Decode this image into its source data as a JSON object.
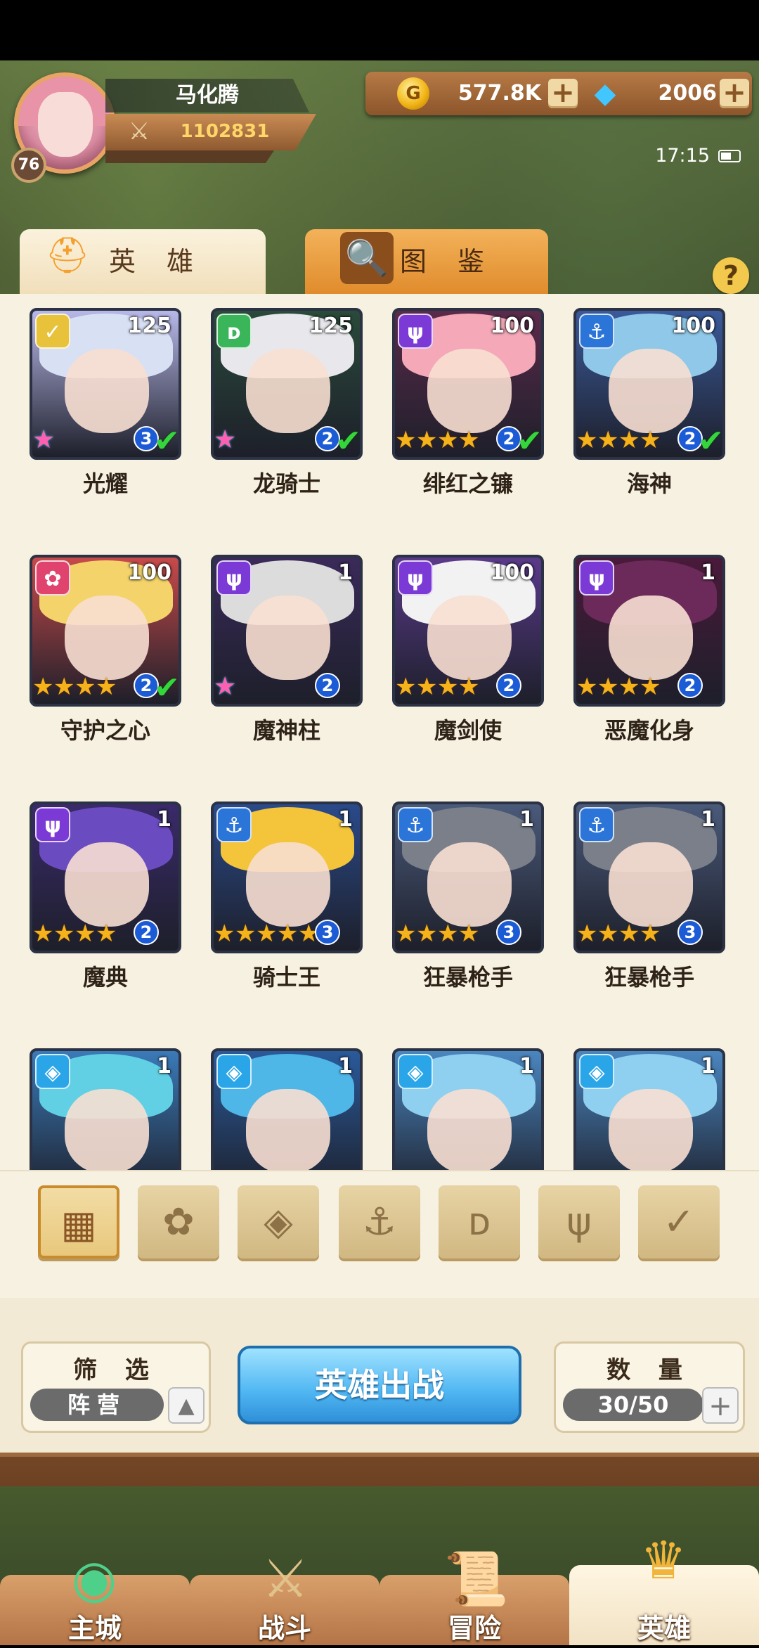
{
  "header": {
    "player_name": "马化腾",
    "player_level": "76",
    "power": "1102831",
    "gold": "577.8K",
    "gems": "2006",
    "clock": "17:15"
  },
  "tabs": [
    {
      "label": "英 雄",
      "icon": "helmet-icon",
      "active": true
    },
    {
      "label": "图 鉴",
      "icon": "magnifier-icon",
      "active": false
    }
  ],
  "help_label": "?",
  "heroes": [
    {
      "name": "光耀",
      "level": "125",
      "faction": "light",
      "stars": 1,
      "rainbow": true,
      "rank": "3",
      "checked": true
    },
    {
      "name": "龙骑士",
      "level": "125",
      "faction": "dragon",
      "stars": 1,
      "rainbow": true,
      "rank": "2",
      "checked": true
    },
    {
      "name": "绯红之镰",
      "level": "100",
      "faction": "demon",
      "stars": 4,
      "rainbow": false,
      "rank": "2",
      "checked": true
    },
    {
      "name": "海神",
      "level": "100",
      "faction": "sea",
      "stars": 4,
      "rainbow": false,
      "rank": "2",
      "checked": true
    },
    {
      "name": "守护之心",
      "level": "100",
      "faction": "nature",
      "stars": 4,
      "rainbow": false,
      "rank": "2",
      "checked": true
    },
    {
      "name": "魔神柱",
      "level": "1",
      "faction": "demon",
      "stars": 1,
      "rainbow": true,
      "rank": "2",
      "checked": false
    },
    {
      "name": "魔剑使",
      "level": "100",
      "faction": "demon",
      "stars": 4,
      "rainbow": false,
      "rank": "2",
      "checked": false
    },
    {
      "name": "恶魔化身",
      "level": "1",
      "faction": "demon",
      "stars": 4,
      "rainbow": false,
      "rank": "2",
      "checked": false
    },
    {
      "name": "魔典",
      "level": "1",
      "faction": "demon",
      "stars": 4,
      "rainbow": false,
      "rank": "2",
      "checked": false
    },
    {
      "name": "骑士王",
      "level": "1",
      "faction": "sea",
      "stars": 5,
      "rainbow": false,
      "rank": "3",
      "checked": false
    },
    {
      "name": "狂暴枪手",
      "level": "1",
      "faction": "sea",
      "stars": 4,
      "rainbow": false,
      "rank": "3",
      "checked": false
    },
    {
      "name": "狂暴枪手",
      "level": "1",
      "faction": "sea",
      "stars": 4,
      "rainbow": false,
      "rank": "3",
      "checked": false
    },
    {
      "name": "",
      "level": "1",
      "faction": "ice",
      "stars": 0,
      "rainbow": false,
      "rank": "",
      "checked": false
    },
    {
      "name": "",
      "level": "1",
      "faction": "ice",
      "stars": 0,
      "rainbow": false,
      "rank": "",
      "checked": false
    },
    {
      "name": "",
      "level": "1",
      "faction": "ice",
      "stars": 0,
      "rainbow": false,
      "rank": "",
      "checked": false
    },
    {
      "name": "",
      "level": "1",
      "faction": "ice",
      "stars": 0,
      "rainbow": false,
      "rank": "",
      "checked": false
    }
  ],
  "faction_filters": [
    {
      "icon": "grid-icon",
      "active": true
    },
    {
      "icon": "nature-faction-icon",
      "active": false
    },
    {
      "icon": "ice-faction-icon",
      "active": false
    },
    {
      "icon": "anchor-faction-icon",
      "active": false
    },
    {
      "icon": "dragon-faction-icon",
      "active": false
    },
    {
      "icon": "demon-faction-icon",
      "active": false
    },
    {
      "icon": "light-faction-icon",
      "active": false
    }
  ],
  "controls": {
    "filter_title": "筛 选",
    "filter_value": "阵营",
    "deploy_label": "英雄出战",
    "count_title": "数 量",
    "count_value": "30/50"
  },
  "nav": [
    {
      "label": "主城",
      "icon": "city-icon",
      "active": false
    },
    {
      "label": "战斗",
      "icon": "swords-icon",
      "active": false
    },
    {
      "label": "冒险",
      "icon": "scroll-map-icon",
      "active": false
    },
    {
      "label": "英雄",
      "icon": "hero-crest-icon",
      "active": true
    }
  ],
  "colors": {
    "light": "#e8c23a",
    "dragon": "#3ab55a",
    "demon": "#7b3ad6",
    "sea": "#2b74d8",
    "nature": "#e0446e",
    "ice": "#2aa6e8"
  }
}
